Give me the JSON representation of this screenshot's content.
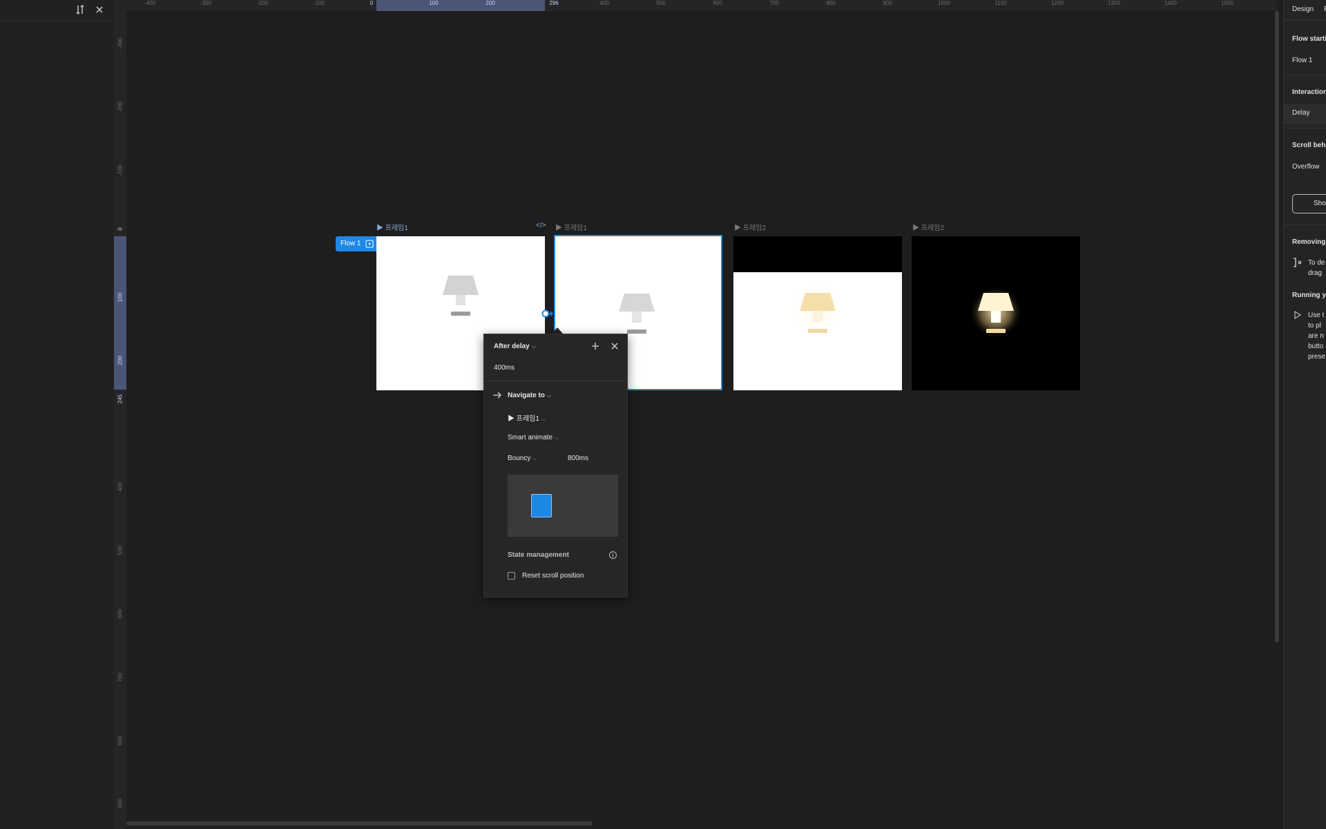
{
  "left_panel": {
    "header_icons": [
      "filter-icon",
      "close-icon"
    ]
  },
  "ruler": {
    "horizontal": [
      "-400",
      "-300",
      "-200",
      "-100",
      "0",
      "100",
      "200",
      "296",
      "400",
      "500",
      "600",
      "700",
      "800",
      "900",
      "1000",
      "1100",
      "1200",
      "1300",
      "1400",
      "1500"
    ],
    "vertical": [
      "-300",
      "-200",
      "-100",
      "0",
      "100",
      "200",
      "245",
      "400",
      "500",
      "600",
      "700",
      "800",
      "900"
    ]
  },
  "canvas": {
    "flow_badge": "Flow 1",
    "frames": [
      {
        "label": "▶ 프레임1",
        "theme": "light-off"
      },
      {
        "label": "▶ 프레임1",
        "theme": "light-off",
        "selected": true
      },
      {
        "label": "▶ 프레임2",
        "theme": "half-glow"
      },
      {
        "label": "▶ 프레임2",
        "theme": "dark-glow"
      }
    ],
    "code_icon": "</>"
  },
  "interaction_popup": {
    "trigger": "After delay",
    "delay": "400ms",
    "action": "Navigate to",
    "destination": "▶ 프레임1",
    "animation": "Smart animate",
    "easing": "Bouncy",
    "duration": "800ms",
    "state_management_label": "State management",
    "reset_scroll_label": "Reset scroll position",
    "reset_scroll_checked": false,
    "accent_color": "#1e88e5"
  },
  "right_panel": {
    "tabs": [
      "Design",
      "P"
    ],
    "flow_starting_title": "Flow starti",
    "flow_name": "Flow 1",
    "interactions_title": "Interaction",
    "interaction_item": "Delay",
    "scroll_title": "Scroll beha",
    "overflow_label": "Overflow",
    "show_button": "Sho",
    "removing_title": "Removing",
    "removing_text": [
      "To de",
      "drag"
    ],
    "running_title": "Running yo",
    "running_text": [
      "Use t",
      "to pl",
      "are n",
      "butto",
      "prese"
    ]
  }
}
